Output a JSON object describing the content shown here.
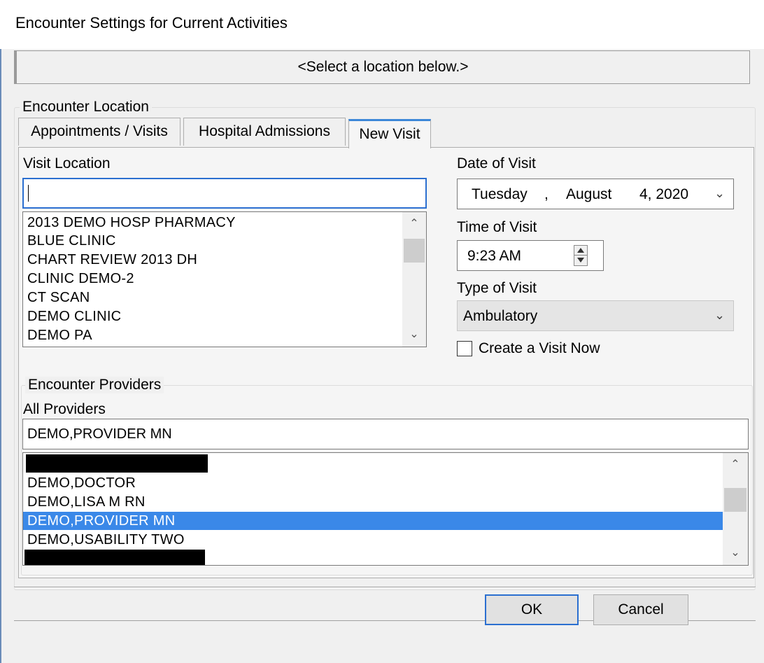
{
  "dialog": {
    "title": "Encounter Settings for Current Activities"
  },
  "status": {
    "text": "<Select a location below.>"
  },
  "location_group": {
    "label": "Encounter Location"
  },
  "tabs": [
    {
      "label": "Appointments / Visits",
      "active": false
    },
    {
      "label": "Hospital Admissions",
      "active": false
    },
    {
      "label": "New Visit",
      "active": true
    }
  ],
  "visit_location": {
    "label": "Visit Location",
    "input_value": "",
    "items": [
      "2013 DEMO HOSP PHARMACY",
      "BLUE CLINIC",
      "CHART REVIEW 2013 DH",
      "CLINIC DEMO-2",
      "CT SCAN",
      "DEMO CLINIC",
      "DEMO PA"
    ]
  },
  "date_of_visit": {
    "label": "Date of Visit",
    "weekday": "Tuesday",
    "sep": ",",
    "month": "August",
    "day_year": "4, 2020"
  },
  "time_of_visit": {
    "label": "Time of Visit",
    "value": "9:23 AM"
  },
  "type_of_visit": {
    "label": "Type of Visit",
    "value": "Ambulatory"
  },
  "create_visit": {
    "label": "Create a Visit Now",
    "checked": false
  },
  "providers_group": {
    "label": "Encounter Providers"
  },
  "providers": {
    "label": "All Providers",
    "input_value": "DEMO,PROVIDER MN",
    "items": [
      {
        "text": "",
        "redacted": true,
        "selected": false
      },
      {
        "text": "DEMO,DOCTOR",
        "redacted": false,
        "selected": false
      },
      {
        "text": "DEMO,LISA M RN",
        "redacted": false,
        "selected": false
      },
      {
        "text": "DEMO,PROVIDER MN",
        "redacted": false,
        "selected": true
      },
      {
        "text": "DEMO,USABILITY TWO",
        "redacted": false,
        "selected": false
      },
      {
        "text": "",
        "redacted": true,
        "selected": false
      }
    ]
  },
  "buttons": {
    "ok": "OK",
    "cancel": "Cancel"
  },
  "icons": {
    "up_arrow": "chevron-up-icon",
    "down_arrow": "chevron-down-icon",
    "spin": "spin-arrows-icon"
  },
  "colors": {
    "focus": "#2b6fd0",
    "selection": "#3a88e8",
    "tab_accent": "#3c87d8"
  }
}
